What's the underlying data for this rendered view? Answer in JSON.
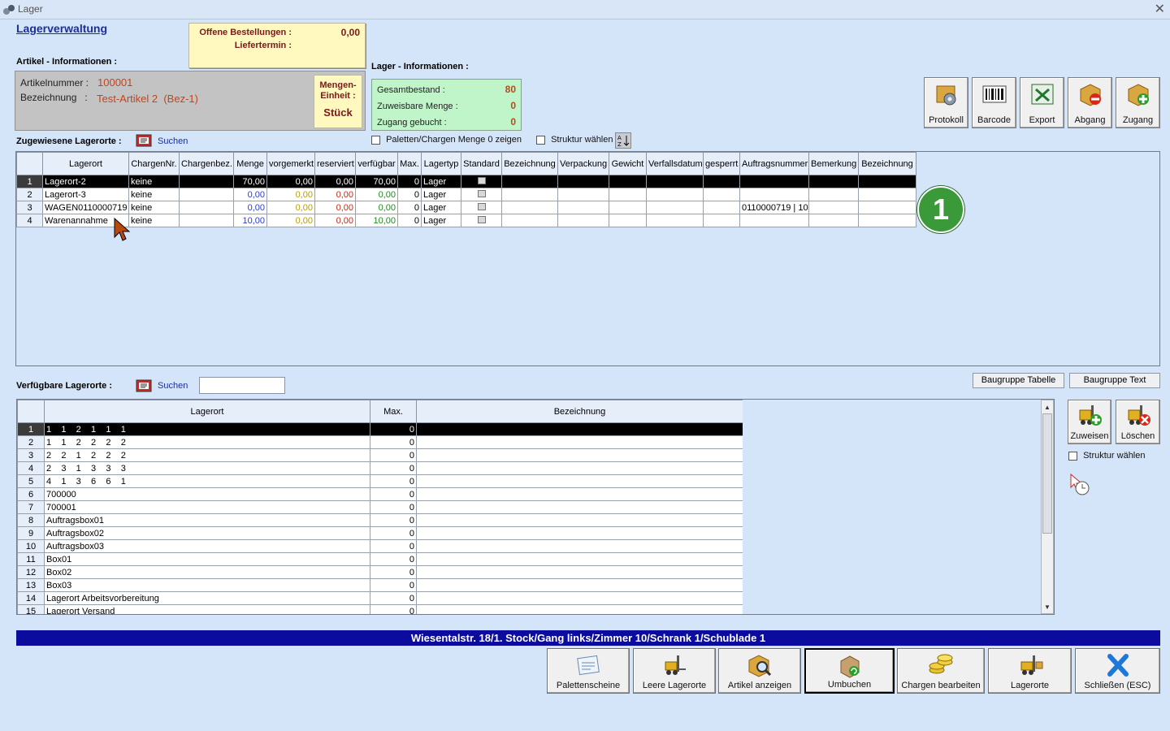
{
  "window": {
    "title": "Lager",
    "close_glyph": "✕"
  },
  "page_title": "Lagerverwaltung",
  "orders": {
    "open_label": "Offene Bestellungen :",
    "open_value": "0,00",
    "delivery_label": "Liefertermin :"
  },
  "article": {
    "section_label": "Artikel - Informationen :",
    "number_label": "Artikelnummer :",
    "number_value": "100001",
    "name_label": "Bezeichnung   :",
    "name_value": "Test-Artikel 2  (Bez-1)",
    "unit_label_1": "Mengen-",
    "unit_label_2": "Einheit :",
    "unit_value": "Stück"
  },
  "lager": {
    "section_label": "Lager - Informationen :",
    "rows": [
      {
        "label": "Gesamtbestand :",
        "value": "80"
      },
      {
        "label": "Zuweisbare Menge :",
        "value": "0"
      },
      {
        "label": "Zugang gebucht :",
        "value": "0"
      }
    ]
  },
  "toolbar": [
    {
      "label": "Protokoll",
      "icon": "protocol-icon"
    },
    {
      "label": "Barcode",
      "icon": "barcode-icon"
    },
    {
      "label": "Export",
      "icon": "excel-export-icon"
    },
    {
      "label": "Abgang",
      "icon": "box-minus-icon"
    },
    {
      "label": "Zugang",
      "icon": "box-plus-icon"
    }
  ],
  "assigned": {
    "label": "Zugewiesene Lagerorte :",
    "search_label": "Suchen",
    "show_zero_label": "Paletten/Chargen Menge 0 zeigen",
    "structure_label": "Struktur wählen",
    "sort_icon": "sort-az-icon",
    "columns": [
      "Lagerort",
      "ChargenNr.",
      "Chargenbez.",
      "Menge",
      "vorgemerkt",
      "reserviert",
      "verfügbar",
      "Max.",
      "Lagertyp",
      "Standard",
      "Bezeichnung",
      "Verpackung",
      "Gewicht",
      "Verfallsdatum",
      "gesperrt",
      "Auftragsnummer",
      "Bemerkung",
      "Bezeichnung"
    ],
    "rows": [
      [
        "1",
        "Lagerort-2",
        "keine",
        "",
        "70,00",
        "0,00",
        "0,00",
        "70,00",
        "0",
        "Lager",
        "",
        "",
        "",
        "",
        "",
        "",
        "",
        "",
        ""
      ],
      [
        "2",
        "Lagerort-3",
        "keine",
        "",
        "0,00",
        "0,00",
        "0,00",
        "0,00",
        "0",
        "Lager",
        "",
        "",
        "",
        "",
        "",
        "",
        "",
        "",
        ""
      ],
      [
        "3",
        "WAGEN0110000719",
        "keine",
        "",
        "0,00",
        "0,00",
        "0,00",
        "0,00",
        "0",
        "Lager",
        "",
        "",
        "",
        "",
        "",
        "",
        "0110000719 | 10",
        "",
        ""
      ],
      [
        "4",
        "Warenannahme",
        "keine",
        "",
        "10,00",
        "0,00",
        "0,00",
        "10,00",
        "0",
        "Lager",
        "",
        "",
        "",
        "",
        "",
        "",
        "",
        "",
        ""
      ]
    ],
    "badge": "1"
  },
  "available": {
    "label": "Verfügbare Lagerorte :",
    "search_label": "Suchen",
    "search_value": "",
    "btn_table": "Baugruppe Tabelle",
    "btn_text": "Baugruppe Text",
    "columns": [
      "Lagerort",
      "Max.",
      "Bezeichnung"
    ],
    "rows": [
      [
        "1",
        "1    1    2    1    1    1",
        "0",
        ""
      ],
      [
        "2",
        "1    1    2    2    2    2",
        "0",
        ""
      ],
      [
        "3",
        "2    2    1    2    2    2",
        "0",
        ""
      ],
      [
        "4",
        "2    3    1    3    3    3",
        "0",
        ""
      ],
      [
        "5",
        "4    1    3    6    6    1",
        "0",
        ""
      ],
      [
        "6",
        "700000",
        "0",
        ""
      ],
      [
        "7",
        "700001",
        "0",
        ""
      ],
      [
        "8",
        "Auftragsbox01",
        "0",
        ""
      ],
      [
        "9",
        "Auftragsbox02",
        "0",
        ""
      ],
      [
        "10",
        "Auftragsbox03",
        "0",
        ""
      ],
      [
        "11",
        "Box01",
        "0",
        ""
      ],
      [
        "12",
        "Box02",
        "0",
        ""
      ],
      [
        "13",
        "Box03",
        "0",
        ""
      ],
      [
        "14",
        "Lagerort Arbeitsvorbereitung",
        "0",
        ""
      ],
      [
        "15",
        "Lagerort Versand",
        "0",
        ""
      ]
    ],
    "assign_label": "Zuweisen",
    "delete_label": "Löschen",
    "structure_label": "Struktur wählen"
  },
  "path": "Wiesentalstr. 18/1. Stock/Gang links/Zimmer 10/Schrank 1/Schublade 1",
  "bottom_buttons": [
    {
      "label": "Palettenscheine",
      "icon": "pallet-slip-icon"
    },
    {
      "label": "Leere Lagerorte",
      "icon": "forklift-icon"
    },
    {
      "label": "Artikel anzeigen",
      "icon": "box-search-icon"
    },
    {
      "label": "Umbuchen",
      "icon": "box-rebook-icon"
    },
    {
      "label": "Chargen bearbeiten",
      "icon": "coins-icon"
    },
    {
      "label": "Lagerorte",
      "icon": "forklift-box-icon"
    },
    {
      "label": "Schließen (ESC)",
      "icon": "close-x-icon"
    }
  ]
}
